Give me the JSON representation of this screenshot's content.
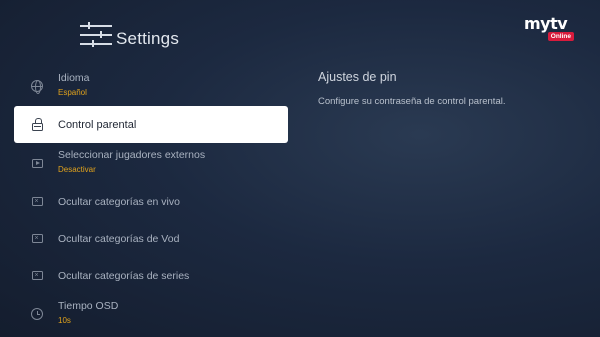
{
  "header": {
    "title": "Settings",
    "icon": "settings-sliders-icon"
  },
  "logo": {
    "text": "mytv",
    "badge": "Online"
  },
  "menu": {
    "items": [
      {
        "label": "Idioma",
        "value": "Español",
        "icon": "globe-icon"
      },
      {
        "label": "Control parental",
        "icon": "lock-icon",
        "active": true
      },
      {
        "label": "Seleccionar jugadores externos",
        "value": "Desactivar",
        "icon": "play-icon"
      },
      {
        "label": "Ocultar categorías en vivo",
        "icon": "hide-icon"
      },
      {
        "label": "Ocultar categorías de Vod",
        "icon": "hide-icon"
      },
      {
        "label": "Ocultar categorías de series",
        "icon": "hide-icon"
      },
      {
        "label": "Tiempo OSD",
        "value": "10s",
        "icon": "clock-icon"
      }
    ]
  },
  "detail": {
    "title": "Ajustes de pin",
    "description": "Configure su contraseña de control parental."
  },
  "colors": {
    "accent": "#e0a21c",
    "badge": "#d81b3c",
    "background": "#1c2940"
  }
}
